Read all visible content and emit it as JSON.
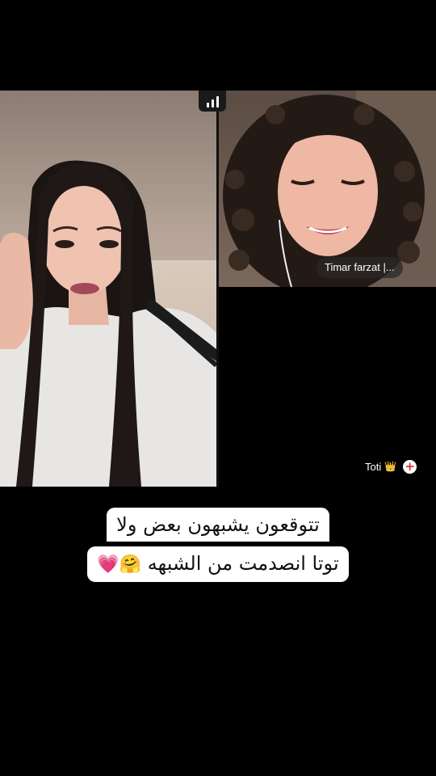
{
  "caption": {
    "line1": "تتوقعون يشبهون بعض ولا",
    "line2": "توتا انصدمت من الشبهه",
    "emojis": "🤗💗"
  },
  "call": {
    "right_name_tag": "Timar farzat |...",
    "guest_name": "Toti",
    "guest_badge": "👑",
    "add_symbol": "+"
  },
  "icons": {
    "signal": "signal-bars-icon",
    "add": "plus-circle-icon"
  }
}
